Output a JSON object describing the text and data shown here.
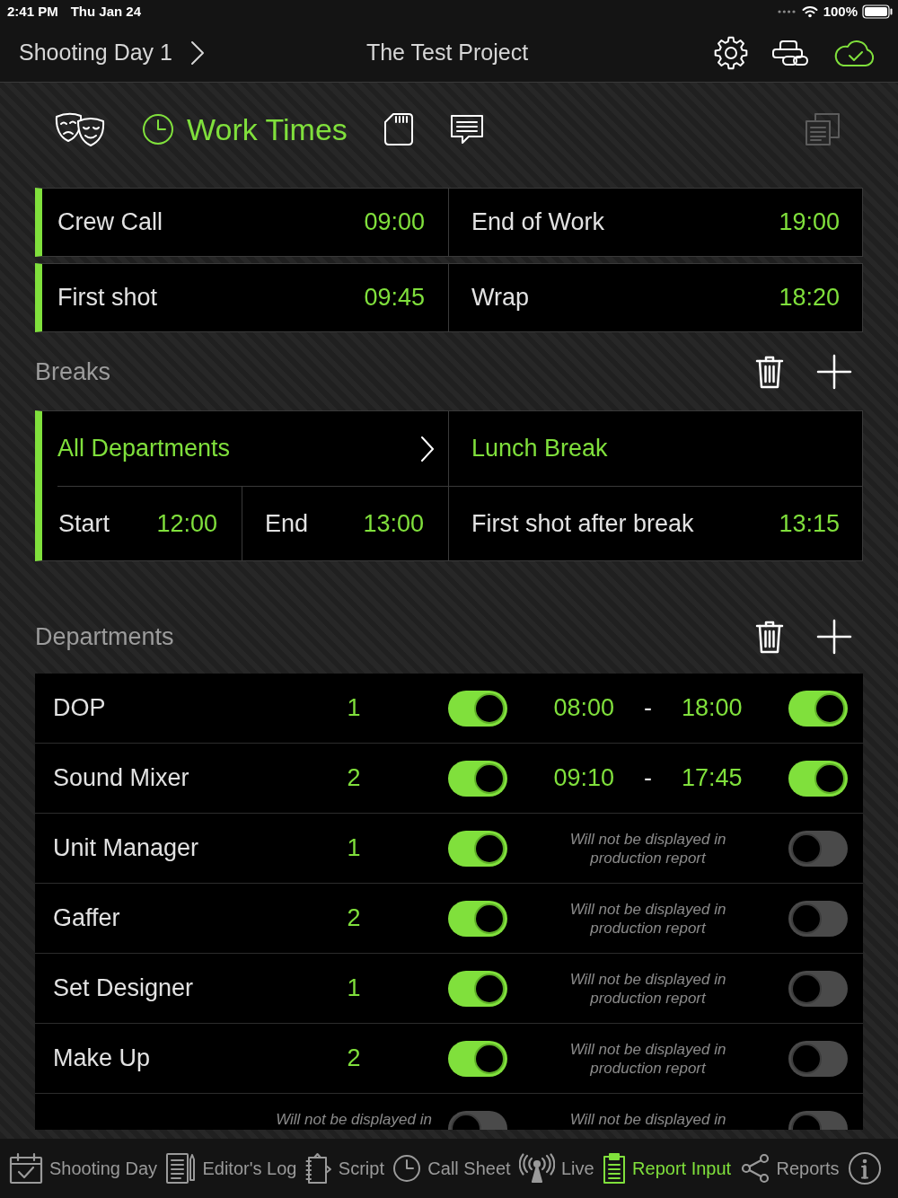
{
  "status_bar": {
    "time": "2:41 PM",
    "date": "Thu Jan 24",
    "battery": "100%"
  },
  "nav_bar": {
    "day": "Shooting Day 1",
    "title": "The Test Project"
  },
  "toolbar": {
    "tabs": [
      {
        "kind": "masks",
        "selected": false
      },
      {
        "kind": "clock",
        "label": "Work Times",
        "selected": true
      },
      {
        "kind": "card",
        "selected": false
      },
      {
        "kind": "chat",
        "selected": false
      }
    ],
    "copy_button": {
      "disabled": true
    }
  },
  "work_times": [
    {
      "label": "Crew Call",
      "time": "09:00"
    },
    {
      "label": "End of Work",
      "time": "19:00"
    },
    {
      "label": "First shot",
      "time": "09:45"
    },
    {
      "label": "Wrap",
      "time": "18:20"
    }
  ],
  "breaks": {
    "title": "Breaks",
    "items": [
      {
        "departments": "All Departments",
        "name": "Lunch Break",
        "fields": [
          {
            "label": "Start",
            "time": "12:00"
          },
          {
            "label": "End",
            "time": "13:00"
          },
          {
            "label": "First shot after break",
            "time": "13:15"
          }
        ]
      }
    ]
  },
  "departments": {
    "title": "Departments",
    "rows": [
      {
        "name": "DOP",
        "count": "1",
        "start": "08:00",
        "separator": "-",
        "end": "18:00",
        "switches": [
          {
            "on": true
          },
          {
            "on": true
          }
        ]
      },
      {
        "name": "Sound Mixer",
        "count": "2",
        "start": "09:10",
        "separator": "-",
        "end": "17:45",
        "switches": [
          {
            "on": true
          },
          {
            "on": true
          }
        ]
      },
      {
        "name": "Unit Manager",
        "count": "1",
        "switches": [
          {
            "on": true
          },
          {
            "on": false,
            "note": "Will not be displayed in production report"
          }
        ]
      },
      {
        "name": "Gaffer",
        "count": "2",
        "switches": [
          {
            "on": true
          },
          {
            "on": false,
            "note": "Will not be displayed in production report"
          }
        ]
      },
      {
        "name": "Set Designer",
        "count": "1",
        "switches": [
          {
            "on": true
          },
          {
            "on": false,
            "note": "Will not be displayed in production report"
          }
        ]
      },
      {
        "name": "Make Up",
        "count": "2",
        "switches": [
          {
            "on": true
          },
          {
            "on": false,
            "note": "Will not be displayed in production report"
          }
        ]
      },
      {
        "switches": [
          {
            "on": false,
            "note": "Will not be displayed in"
          },
          {
            "on": false,
            "note": "Will not be displayed in"
          }
        ]
      }
    ]
  },
  "tab_bar": [
    {
      "kind": "calendar",
      "label": "Shooting Day",
      "selected": false
    },
    {
      "kind": "log",
      "label": "Editor's Log",
      "selected": false
    },
    {
      "kind": "script",
      "label": "Script",
      "selected": false
    },
    {
      "kind": "clock",
      "label": "Call Sheet",
      "selected": false
    },
    {
      "kind": "live",
      "label": "Live",
      "selected": false
    },
    {
      "kind": "clipboard",
      "label": "Report Input",
      "selected": true
    },
    {
      "kind": "share",
      "label": "Reports",
      "selected": false
    },
    {
      "kind": "info",
      "selected": false
    }
  ]
}
